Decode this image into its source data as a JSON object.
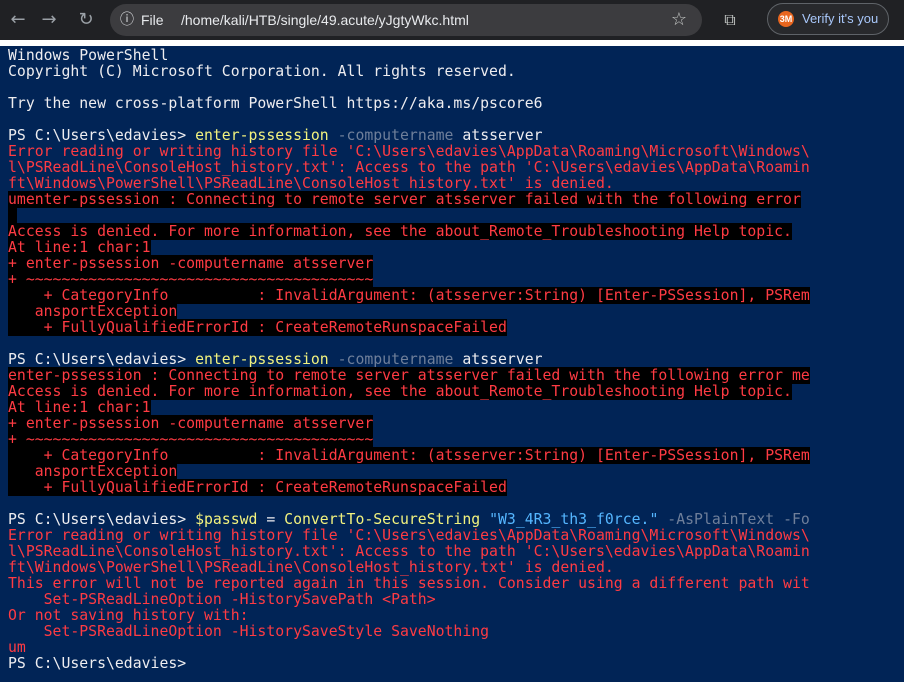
{
  "browser": {
    "scheme_label": "File",
    "url": "/home/kali/HTB/single/49.acute/yJgtyWkc.html",
    "verify_label": "Verify it's you",
    "verify_logo": "3M"
  },
  "terminal": {
    "header1": "Windows PowerShell",
    "header2": "Copyright (C) Microsoft Corporation. All rights reserved.",
    "header3": "Try the new cross-platform PowerShell https://aka.ms/pscore6",
    "prompt": "PS C:\\Users\\edavies> ",
    "cmd1_name": "enter-pssession",
    "cmd1_param": "-computername",
    "cmd1_arg": "atsserver",
    "hist_err_1": "Error reading or writing history file 'C:\\Users\\edavies\\AppData\\Roaming\\Microsoft\\Windows\\",
    "hist_err_2": "l\\PSReadLine\\ConsoleHost_history.txt': Access to the path 'C:\\Users\\edavies\\AppData\\Roamin",
    "hist_err_3": "ft\\Windows\\PowerShell\\PSReadLine\\ConsoleHost_history.txt' is denied.",
    "err_connect_a": "umenter-pssession : Connecting to remote server atsserver failed with the following error",
    "err_connect_b": "enter-pssession : Connecting to remote server atsserver failed with the following error me",
    "err_access": "Access is denied. For more information, see the about_Remote_Troubleshooting Help topic.",
    "err_atline": "At line:1 char:1",
    "err_cmdline": "+ enter-pssession -computername atsserver",
    "err_tilde": "+ ~~~~~~~~~~~~~~~~~~~~~~~~~~~~~~~~~~~~~~~",
    "err_catinfo": "    + CategoryInfo          : InvalidArgument: (atsserver:String) [Enter-PSSession], PSRem",
    "err_transport": "   ansportException",
    "err_fqid": "    + FullyQualifiedErrorId : CreateRemoteRunspaceFailed",
    "cmd3_var": "$passwd",
    "cmd3_eq": " = ",
    "cmd3_func": "ConvertTo-SecureString",
    "cmd3_string": "\"W3_4R3_th3_f0rce.\"",
    "cmd3_param": "-AsPlainText -Fo",
    "note_1": "This error will not be reported again in this session. Consider using a different path wit",
    "note_2": "    Set-PSReadLineOption -HistorySavePath <Path>",
    "note_3": "Or not saving history with:",
    "note_4": "    Set-PSReadLineOption -HistorySaveStyle SaveNothing",
    "note_5": "um",
    "final_prompt": "PS C:\\Users\\edavies>"
  },
  "colors": {
    "console_background": "#012456",
    "error_text": "#ff3b43",
    "command_text": "#f2f27e",
    "parameter_text": "#6f7f9a",
    "string_text": "#55b6ff"
  },
  "icons": [
    "back-arrow-icon",
    "forward-arrow-icon",
    "reload-icon",
    "site-info-icon",
    "star-icon",
    "extensions-icon",
    "profile-logo-icon"
  ]
}
